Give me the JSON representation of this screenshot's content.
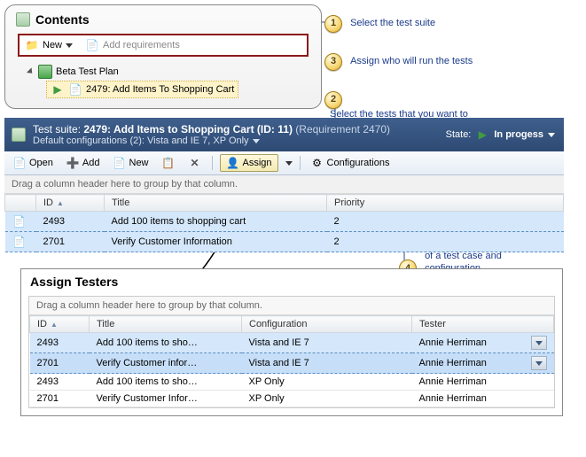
{
  "annotations": {
    "a1": "Select the test suite",
    "a2": "Select the tests that you want to assign to different testers",
    "a3": "Assign who will run the tests",
    "a4": "Edit who will run each pairing of a test case and configuration"
  },
  "contents": {
    "title": "Contents",
    "new_label": "New",
    "add_req_label": "Add requirements",
    "plan_label": "Beta Test Plan",
    "child_label": "2479: Add Items To Shopping Cart"
  },
  "suite_header": {
    "prefix": "Test suite:  ",
    "title": "2479: Add Items to Shopping Cart (ID: 11)",
    "requirement": "(Requirement 2470)",
    "configs": "Default configurations (2): Vista and IE 7, XP Only",
    "state_label": "State:",
    "state_value": "In progess"
  },
  "toolbar": {
    "open": "Open",
    "add": "Add",
    "new": "New",
    "assign": "Assign",
    "configs": "Configurations"
  },
  "grid1": {
    "group_hint": "Drag a column header here to group by that column.",
    "cols": {
      "id": "ID",
      "title": "Title",
      "priority": "Priority"
    },
    "rows": [
      {
        "id": "2493",
        "title": "Add 100 items to shopping cart",
        "priority": "2"
      },
      {
        "id": "2701",
        "title": "Verify Customer Information",
        "priority": "2"
      }
    ]
  },
  "assign_dialog": {
    "title": "Assign Testers",
    "group_hint": "Drag a column header here to group by that column.",
    "cols": {
      "id": "ID",
      "title": "Title",
      "config": "Configuration",
      "tester": "Tester"
    },
    "rows": [
      {
        "id": "2493",
        "title": "Add 100 items to sho…",
        "config": "Vista and IE 7",
        "tester": "Annie Herriman",
        "sel": true,
        "dd": true
      },
      {
        "id": "2701",
        "title": "Verify Customer infor…",
        "config": "Vista and IE 7",
        "tester": "Annie Herriman",
        "sel": true,
        "dd": true
      },
      {
        "id": "2493",
        "title": "Add 100 items to sho…",
        "config": "XP Only",
        "tester": "Annie Herriman",
        "sel": false,
        "dd": false
      },
      {
        "id": "2701",
        "title": "Verify Customer Infor…",
        "config": "XP Only",
        "tester": "Annie Herriman",
        "sel": false,
        "dd": false
      }
    ]
  }
}
